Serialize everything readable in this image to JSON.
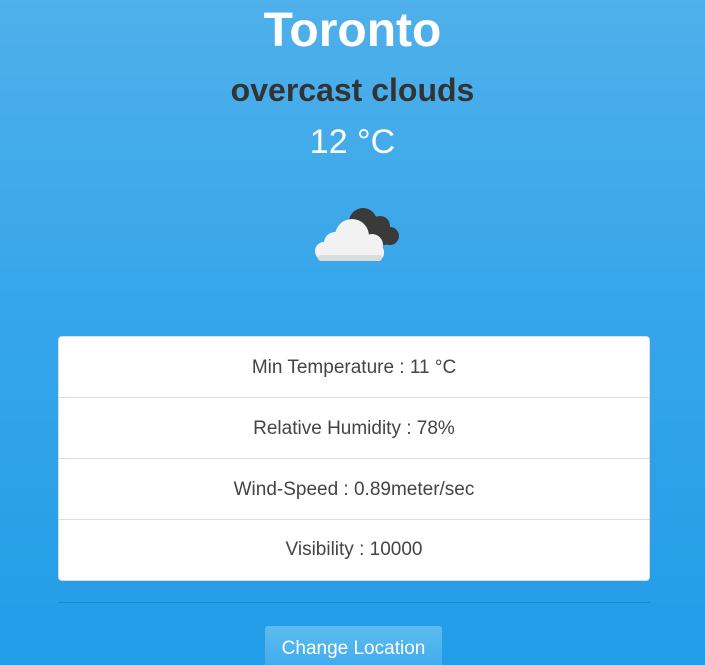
{
  "weather": {
    "city": "Toronto",
    "description": "overcast clouds",
    "temperature": "12 °C",
    "icon": "overcast-clouds-icon"
  },
  "details": [
    {
      "text": "Min Temperature : 11 °C"
    },
    {
      "text": "Relative Humidity : 78%"
    },
    {
      "text": "Wind-Speed : 0.89meter/sec"
    },
    {
      "text": "Visibility : 10000"
    }
  ],
  "actions": {
    "change_location_label": "Change Location"
  },
  "colors": {
    "background_top": "#4fb0ea",
    "background_bottom": "#229de8",
    "title_text": "#ffffff",
    "description_text": "#333333",
    "panel_background": "#ffffff",
    "cloud_light": "#f2f2f2",
    "cloud_dark": "#3a3a3a"
  }
}
